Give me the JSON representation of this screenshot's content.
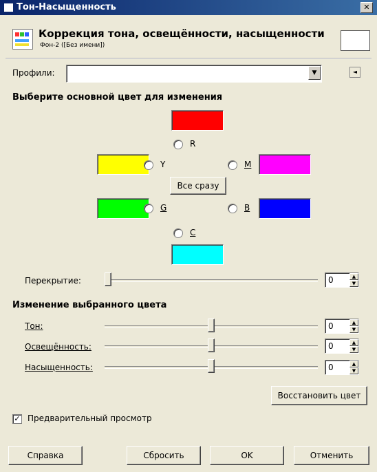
{
  "window": {
    "title": "Тон-Насыщенность",
    "close_glyph": "✕"
  },
  "header": {
    "title": "Коррекция тона, освещённости, насыщенности",
    "subtitle": "Фон-2 ([Без имени])"
  },
  "profiles": {
    "label": "Профили:",
    "value": ""
  },
  "select_color": {
    "heading": "Выберите основной цвет для изменения",
    "channels": {
      "r": {
        "label": "R",
        "color": "#ff0000"
      },
      "y": {
        "label": "Y",
        "color": "#ffff00"
      },
      "m": {
        "label": "M",
        "color": "#ff00ff"
      },
      "g": {
        "label": "G",
        "color": "#00ff00"
      },
      "b": {
        "label": "B",
        "color": "#0000ff"
      },
      "c": {
        "label": "C",
        "color": "#00ffff"
      }
    },
    "all_button": "Все сразу"
  },
  "overlap": {
    "label": "Перекрытие:",
    "value": "0",
    "level": 0
  },
  "adjust": {
    "heading": "Изменение выбранного цвета",
    "hue": {
      "label": "Тон:",
      "value": "0",
      "level": 0.5
    },
    "lightness": {
      "label": "Освещённость:",
      "value": "0",
      "level": 0.5
    },
    "saturation": {
      "label": "Насыщенность:",
      "value": "0",
      "level": 0.5
    },
    "reset_color": "Восстановить цвет"
  },
  "preview": {
    "label": "Предварительный просмотр",
    "checked": true
  },
  "buttons": {
    "help": "Справка",
    "reset": "Сбросить",
    "ok": "OK",
    "cancel": "Отменить"
  }
}
